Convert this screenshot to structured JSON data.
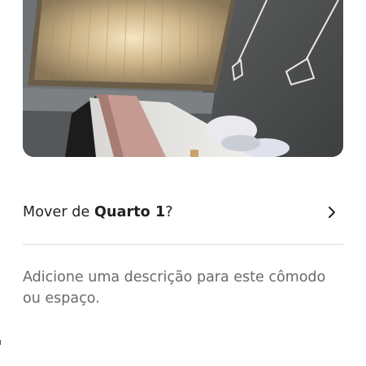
{
  "photo": {
    "subject": "bedroom-photo"
  },
  "move_row": {
    "prefix": "Mover de ",
    "room_name": "Quarto 1",
    "suffix": "?",
    "icon": "chevron-right-icon"
  },
  "description": {
    "placeholder": "Adicione uma descrição para este cômodo ou espaço."
  },
  "colors": {
    "text_primary": "#222222",
    "text_secondary": "#6a6a6a",
    "divider": "#dddddd",
    "background": "#ffffff"
  }
}
